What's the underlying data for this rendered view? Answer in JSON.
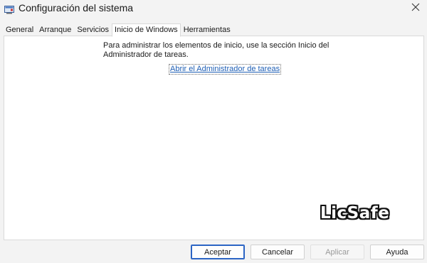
{
  "window": {
    "title": "Configuración del sistema",
    "close_glyph": "✕"
  },
  "tabs": [
    {
      "label": "General",
      "active": false
    },
    {
      "label": "Arranque",
      "active": false
    },
    {
      "label": "Servicios",
      "active": false
    },
    {
      "label": "Inicio de Windows",
      "active": true
    },
    {
      "label": "Herramientas",
      "active": false
    }
  ],
  "content": {
    "description": "Para administrar los elementos de inicio, use la sección Inicio del Administrador de tareas.",
    "link_text": "Abrir el Administrador de tareas"
  },
  "buttons": {
    "accept": "Aceptar",
    "cancel": "Cancelar",
    "apply": "Aplicar",
    "help": "Ayuda"
  },
  "watermark": {
    "text": "LicSafe"
  },
  "icons": {
    "app": "msconfig-window-icon",
    "close": "close-icon"
  },
  "colors": {
    "link": "#1f5fb5",
    "default_button_border": "#2b64c4",
    "window_background": "#f3f3f3",
    "panel_background": "#ffffff"
  }
}
